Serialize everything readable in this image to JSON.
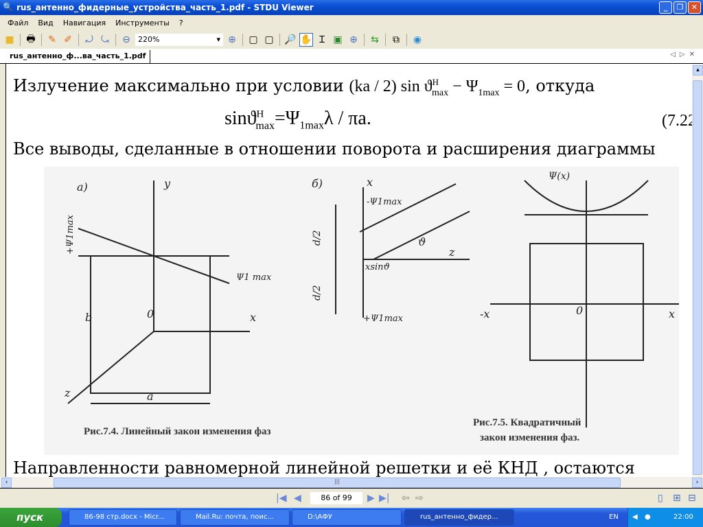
{
  "window": {
    "title": "rus_антенно_фидерные_устройства_часть_1.pdf - STDU Viewer"
  },
  "menu": [
    "Файл",
    "Вид",
    "Навигация",
    "Инструменты",
    "?"
  ],
  "toolbar": {
    "zoom": "220%"
  },
  "tab": {
    "label": "rus_антенно_ф...ва_часть_1.pdf"
  },
  "document": {
    "line1_text": "Излучение максимально при условии",
    "line1_math": "(ka / 2) sin ϑ",
    "line1_math_sup": "H",
    "line1_math_sub": "max",
    "line1_math2": " − Ψ",
    "line1_math2_sub": "1max",
    "line1_math3": " = 0",
    "line1_end": ", откуда",
    "formula": "sinϑ",
    "formula_sup": "H",
    "formula_sub": "max",
    "formula_rest": "=Ψ",
    "formula_rest_sub": "1max",
    "formula_end": "λ / πa.",
    "formula_number": "(7.22",
    "line3": "Все выводы, сделанные в отношении поворота и расширения диаграммы",
    "caption_74": "Рис.7.4. Линейный закон изменения фаз",
    "caption_75_1": "Рис.7.5. Квадратичный",
    "caption_75_2": "закон изменения фаз.",
    "last_line": "Направленности равномерной линейной  решетки и её КНД , остаются",
    "fig_labels": {
      "a": "а)",
      "b": "б)",
      "y": "y",
      "x": "x",
      "z": "z",
      "o": "0",
      "b_len": "b",
      "a_len": "a",
      "psi_max_plus": "+Ψ1max",
      "psi_max": "Ψ1 max",
      "minus_psi": "-Ψ1max",
      "half": "d/2",
      "theta": "ϑ",
      "xsin": "xsinϑ",
      "plus_psi": "+Ψ1max",
      "psi_x": "Ψ(x)",
      "minus_x": "-x"
    }
  },
  "navigation": {
    "page": "86 of 99"
  },
  "taskbar": {
    "start": "пуск",
    "tasks": [
      "86-98 стр.docx - Micr...",
      "Mail.Ru: почта, поис...",
      "D:\\АФУ",
      "rus_антенно_фидер..."
    ],
    "lang": "EN",
    "time": "22:00"
  }
}
